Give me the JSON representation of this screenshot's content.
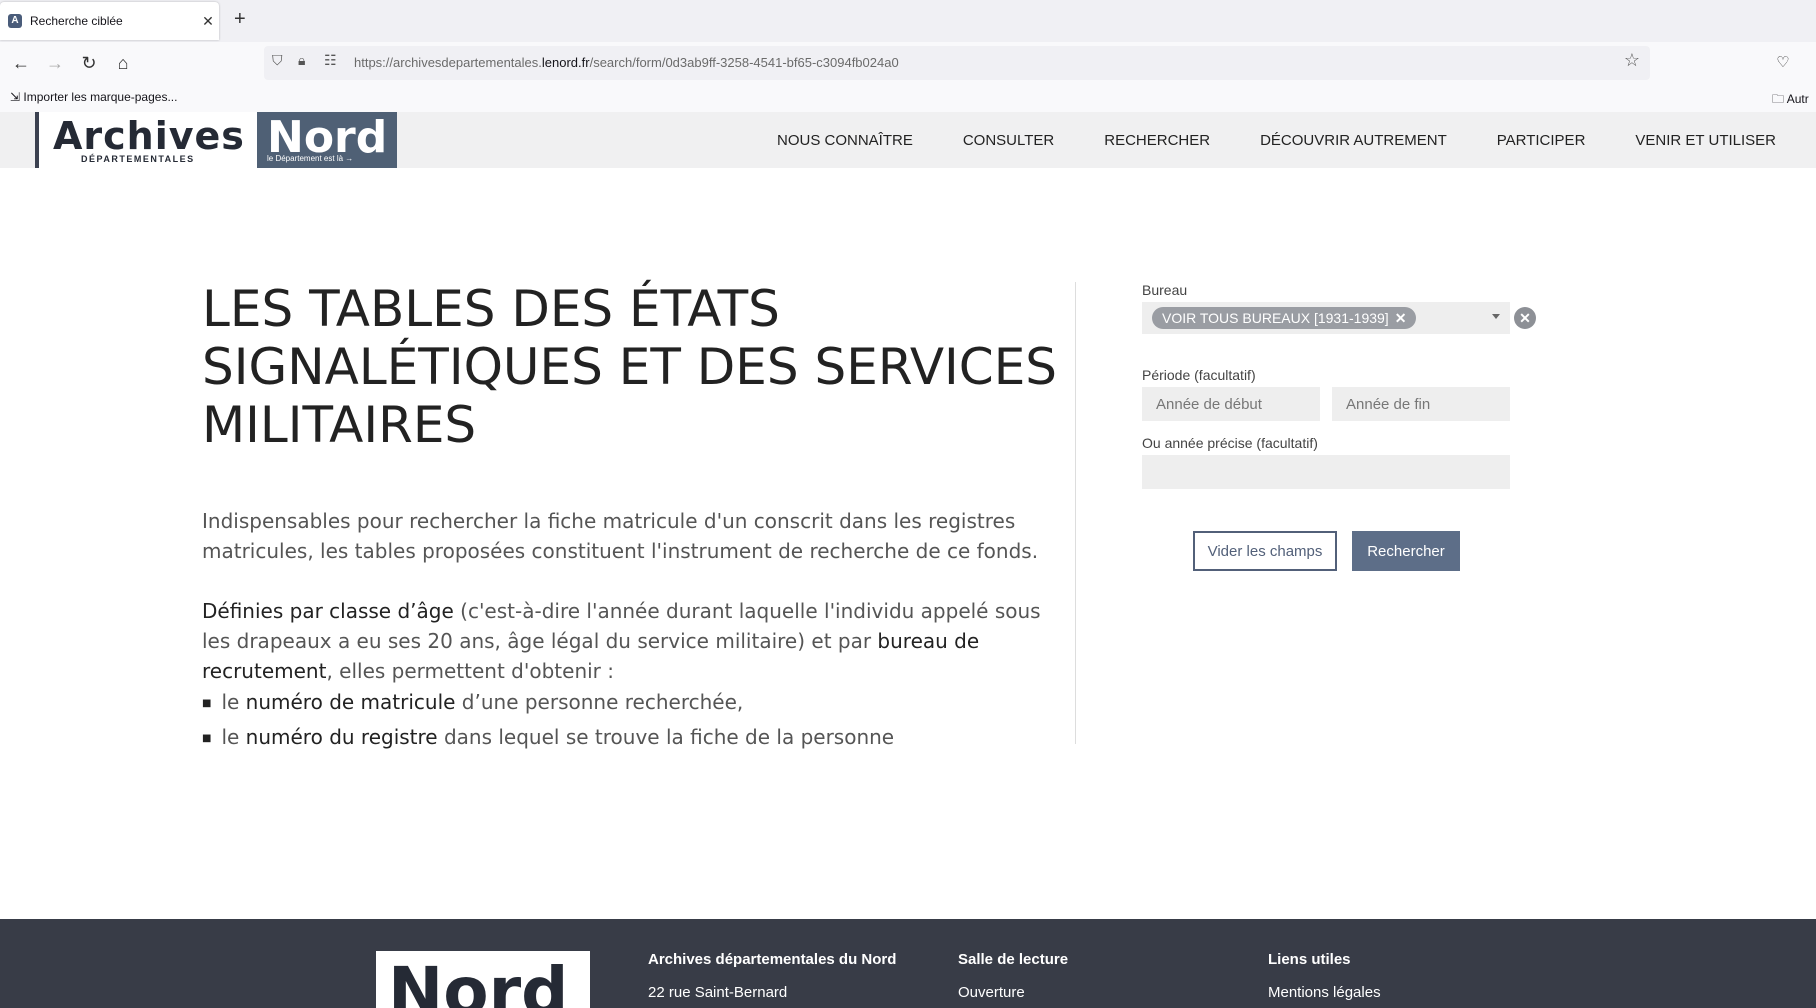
{
  "browser": {
    "tab_title": "Recherche ciblée",
    "url_prefix": "https://archivesdepartementales.",
    "url_domain": "lenord.fr",
    "url_path": "/search/form/0d3ab9ff-3258-4541-bf65-c3094fb024a0",
    "bookmark_import": "Importer les marque-pages...",
    "bookmark_other": "Autr"
  },
  "header": {
    "logo_archives": "Archives",
    "logo_departementales": "DÉPARTEMENTALES",
    "logo_nord": "Nord",
    "logo_tagline": "le Département est là →",
    "menu": [
      "NOUS CONNAÎTRE",
      "CONSULTER",
      "RECHERCHER",
      "DÉCOUVRIR AUTREMENT",
      "PARTICIPER",
      "VENIR ET UTILISER"
    ]
  },
  "main": {
    "title": "LES TABLES DES ÉTATS SIGNALÉTIQUES ET DES SERVICES MILITAIRES",
    "intro": "Indispensables pour rechercher la fiche matricule d'un conscrit dans les registres matricules, les tables proposées constituent l'instrument de recherche de ce fonds.",
    "p2": {
      "s1": "Définies par classe d’âge",
      "t1": " (c'est-à-dire l'année durant laquelle l'individu appelé sous les drapeaux a eu ses 20 ans, âge légal du service militaire) et par ",
      "s2": "bureau de recrutement",
      "t2": ", elles permettent d'obtenir :"
    },
    "bullets": [
      {
        "pre": "le ",
        "strong": "numéro de matricule",
        "post": " d’une personne recherchée,"
      },
      {
        "pre": "le ",
        "strong": "numéro du registre",
        "post": " dans lequel se trouve la fiche de la personne"
      }
    ]
  },
  "form": {
    "bureau_label": "Bureau",
    "bureau_chip": "VOIR TOUS BUREAUX [1931-1939]",
    "periode_label": "Période (facultatif)",
    "start_placeholder": "Année de début",
    "end_placeholder": "Année de fin",
    "annee_label": "Ou année précise (facultatif)",
    "annee_value": "",
    "clear_button": "Vider les champs",
    "search_button": "Rechercher"
  },
  "footer": {
    "logo": "Nord",
    "col1_heading": "Archives départementales du Nord",
    "col1_line": "22 rue Saint-Bernard",
    "col2_heading": "Salle de lecture",
    "col2_link": "Ouverture",
    "col3_heading": "Liens utiles",
    "col3_link": "Mentions légales"
  }
}
